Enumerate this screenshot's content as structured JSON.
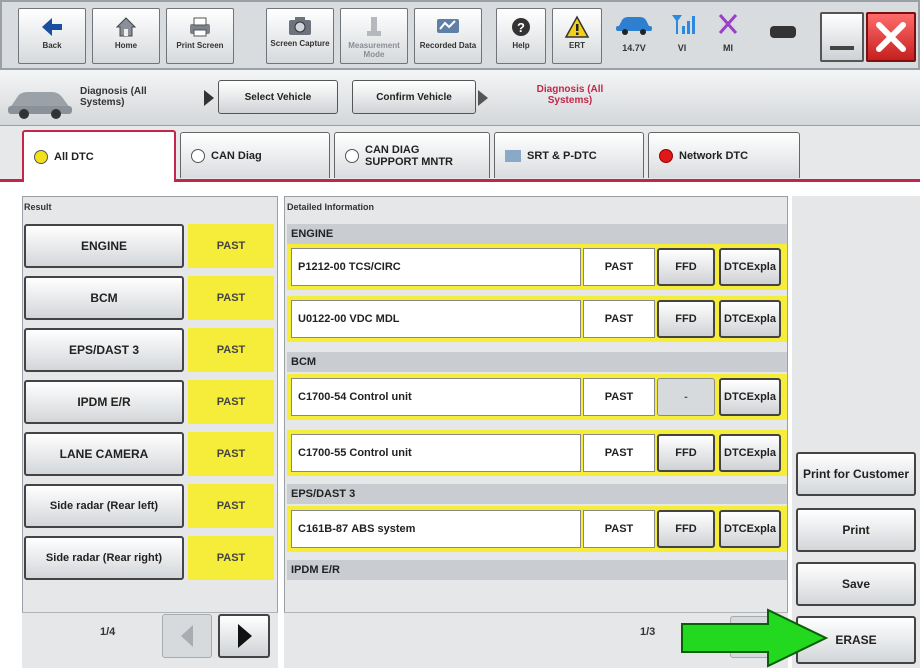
{
  "toolbar": {
    "buttons": [
      {
        "label": "Back",
        "icon": "back-arrow-icon"
      },
      {
        "label": "Home",
        "icon": "home-icon"
      },
      {
        "label": "Print Screen",
        "icon": "printer-icon"
      },
      {
        "label": "Screen Capture",
        "icon": "camera-icon"
      },
      {
        "label": "Measurement Mode",
        "icon": "measurement-icon"
      },
      {
        "label": "Recorded Data",
        "icon": "recorded-data-icon"
      },
      {
        "label": "Help",
        "icon": "help-icon"
      },
      {
        "label": "ERT",
        "icon": "warning-icon"
      }
    ],
    "voltage": "14.7V",
    "vi_label": "VI",
    "mi_label": "MI"
  },
  "breadcrumb": {
    "current_label": "Diagnosis (All Systems)",
    "steps": [
      "Select Vehicle",
      "Confirm Vehicle",
      "Diagnosis (All Systems)"
    ]
  },
  "tabs": [
    "All DTC",
    "CAN Diag",
    "CAN DIAG SUPPORT MNTR",
    "SRT & P-DTC",
    "Network DTC"
  ],
  "result": {
    "header": "Result",
    "systems": [
      {
        "name": "ENGINE",
        "status": "PAST"
      },
      {
        "name": "BCM",
        "status": "PAST"
      },
      {
        "name": "EPS/DAST 3",
        "status": "PAST"
      },
      {
        "name": "IPDM E/R",
        "status": "PAST"
      },
      {
        "name": "LANE CAMERA",
        "status": "PAST"
      },
      {
        "name": "Side radar (Rear left)",
        "status": "PAST"
      },
      {
        "name": "Side radar (Rear right)",
        "status": "PAST"
      }
    ],
    "page": "1/4"
  },
  "detail": {
    "header": "Detailed Information",
    "groups": {
      "engine": "ENGINE",
      "bcm": "BCM",
      "eps": "EPS/DAST 3",
      "ipdm": "IPDM E/R"
    },
    "rows": [
      {
        "code": "P1212-00",
        "desc": "TCS/CIRC",
        "status": "PAST",
        "ffd": "FFD",
        "dtc": "DTC",
        "expla": "Expla"
      },
      {
        "code": "U0122-00",
        "desc": "VDC MDL",
        "status": "PAST",
        "ffd": "FFD",
        "dtc": "DTC",
        "expla": "Expla"
      },
      {
        "code": "C1700-54",
        "desc": "Control unit",
        "status": "PAST",
        "ffd": "-",
        "dtc": "DTC",
        "expla": "Expla"
      },
      {
        "code": "C1700-55",
        "desc": "Control unit",
        "status": "PAST",
        "ffd": "FFD",
        "dtc": "DTC",
        "expla": "Expla"
      },
      {
        "code": "C161B-87",
        "desc": "ABS system",
        "status": "PAST",
        "ffd": "FFD",
        "dtc": "DTC",
        "expla": "Expla"
      }
    ],
    "page": "1/3"
  },
  "actions": {
    "print_customer": "Print for Customer",
    "print": "Print",
    "save": "Save",
    "erase": "ERASE"
  },
  "colors": {
    "accent": "#c2264b",
    "past_yellow": "#f6ed3a",
    "arrow_green": "#22d91f"
  }
}
